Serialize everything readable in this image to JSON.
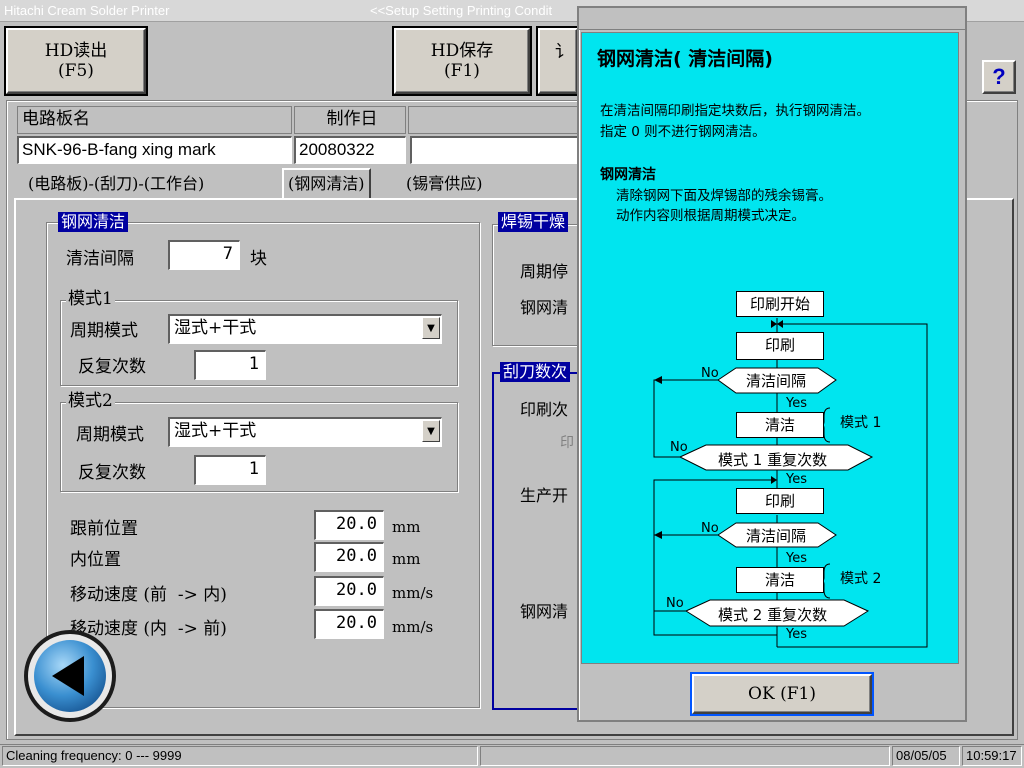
{
  "app_title": "Hitachi Cream Solder Printer",
  "window_title": "<<Setup Setting Printing Condit",
  "toolbar": {
    "hd_read": {
      "line1": "HD读出",
      "line2": "(F5)"
    },
    "hd_save": {
      "line1": "HD保存",
      "line2": "(F1)"
    },
    "third_partial": "讠",
    "help_label": "?"
  },
  "board": {
    "name_label": "电路板名",
    "date_label": "制作日",
    "name_value": "SNK-96-B-fang xing mark",
    "date_value": "20080322"
  },
  "tabs": [
    "(电路板)-(刮刀)-(工作台)",
    "(钢网清洁)",
    "(锡膏供应)"
  ],
  "stencil_clean": {
    "title": "钢网清洁",
    "interval_label": "清洁间隔",
    "interval_value": "7",
    "interval_unit": "块",
    "mode1": {
      "title": "模式1",
      "cycle_label": "周期模式",
      "cycle_value": "湿式+干式",
      "repeat_label": "反复次数",
      "repeat_value": "1"
    },
    "mode2": {
      "title": "模式2",
      "cycle_label": "周期模式",
      "cycle_value": "湿式+干式",
      "repeat_label": "反复次数",
      "repeat_value": "1"
    },
    "rows": [
      {
        "label": "跟前位置",
        "value": "20.0",
        "unit": "mm"
      },
      {
        "label": "内位置",
        "value": "20.0",
        "unit": "mm"
      },
      {
        "label": "移动速度 (前  -> 内)",
        "value": "20.0",
        "unit": "mm/s"
      },
      {
        "label": "移动速度 (内  -> 前)",
        "value": "20.0",
        "unit": "mm/s"
      }
    ]
  },
  "solder_dry": {
    "title": "焊锡干燥",
    "row1": "周期停",
    "row2": "钢网清"
  },
  "squeegee": {
    "title": "刮刀数次",
    "row1": "印刷次",
    "row1b": "印",
    "row2": "生产开",
    "row3": "钢网清"
  },
  "dialog": {
    "title": "钢网清洁( 清洁间隔)",
    "desc1": "在清洁间隔印刷指定块数后，执行钢网清洁。",
    "desc2": "指定 0 则不进行钢网清洁。",
    "section_title": "钢网清洁",
    "section1": "清除钢网下面及焊锡部的残余锡膏。",
    "section2": "动作内容则根据周期模式决定。",
    "flow": {
      "start": "印刷开始",
      "print": "印刷",
      "interval": "清洁间隔",
      "clean": "清洁",
      "mode1_repeat": "模式 1 重复次数",
      "mode2_repeat": "模式 2 重复次数",
      "mode1": "模式 1",
      "mode2": "模式 2",
      "yes": "Yes",
      "no": "No"
    },
    "ok_button": "OK (F1)"
  },
  "status": {
    "message": "Cleaning frequency:  0  ---  9999",
    "date": "08/05/05",
    "time": "10:59:17"
  }
}
